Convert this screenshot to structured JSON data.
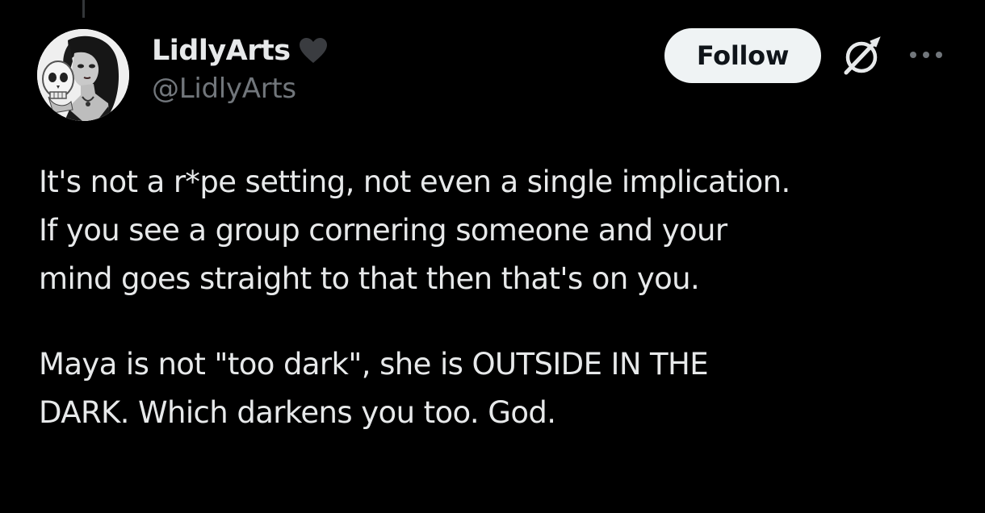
{
  "author": {
    "display_name": "LidlyArts",
    "handle": "@LidlyArts",
    "avatar_icon": "gothic-girl-with-skull-avatar",
    "badge_icon": "heart-icon",
    "badge_color": "#3a3c40"
  },
  "actions": {
    "follow_label": "Follow",
    "grok_icon": "grok-icon",
    "more_icon": "more-horizontal-icon"
  },
  "tweet": {
    "paragraph_1": [
      "It's not a r*pe setting, not even a single implication.",
      "If you see a group cornering someone and your",
      "mind goes straight to that then that's on you."
    ],
    "paragraph_2": [
      "Maya is not \"too dark\", she is OUTSIDE IN THE",
      "DARK. Which darkens you too. God."
    ]
  },
  "colors": {
    "background": "#000000",
    "text_primary": "#e7e9ea",
    "text_secondary": "#71767b",
    "follow_bg": "#eff3f4",
    "follow_text": "#0f1419"
  }
}
